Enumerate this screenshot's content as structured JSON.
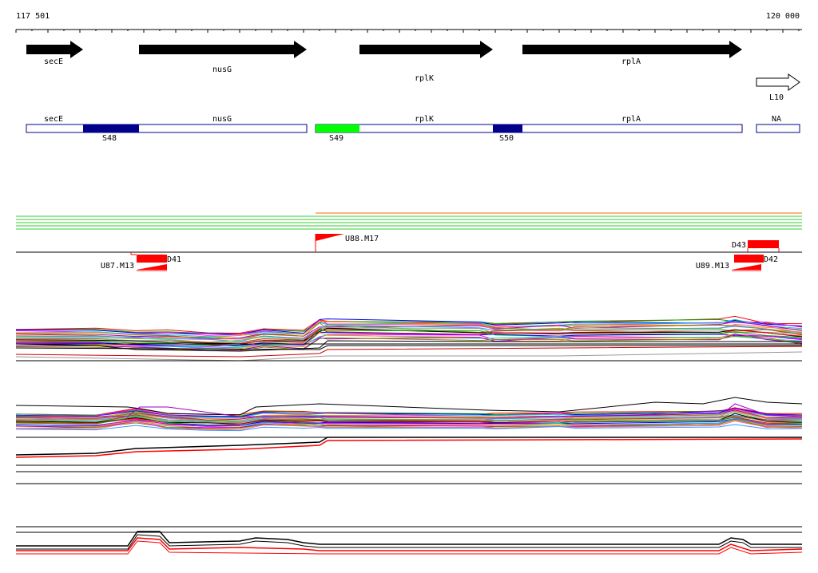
{
  "coords": {
    "start": "117 501",
    "end": "120 000"
  },
  "genes": [
    {
      "label": "secE",
      "dir": "right",
      "style": "filled"
    },
    {
      "label": "nusG",
      "dir": "right",
      "style": "filled"
    },
    {
      "label": "rplK",
      "dir": "right",
      "style": "filled"
    },
    {
      "label": "rplA",
      "dir": "right",
      "style": "filled"
    },
    {
      "label": "L10",
      "dir": "right",
      "style": "outline"
    }
  ],
  "regions": [
    {
      "label": "secE"
    },
    {
      "label": "nusG"
    },
    {
      "label": "rplK"
    },
    {
      "label": "rplA"
    },
    {
      "label": "NA"
    }
  ],
  "segments": [
    {
      "label": "S48",
      "color": "#00008b"
    },
    {
      "label": "S49",
      "color": "#00ff00"
    },
    {
      "label": "S50",
      "color": "#00008b"
    }
  ],
  "features": [
    {
      "label": "U88.M17"
    },
    {
      "label": "D43"
    },
    {
      "label": "D41"
    },
    {
      "label": "U87.M13"
    },
    {
      "label": "D42"
    },
    {
      "label": "U89.M13"
    }
  ],
  "colors": {
    "feature": "#ff0000",
    "green_tracks": "#33cc33",
    "segment_dark": "#00008b",
    "segment_bright": "#00ff00"
  }
}
